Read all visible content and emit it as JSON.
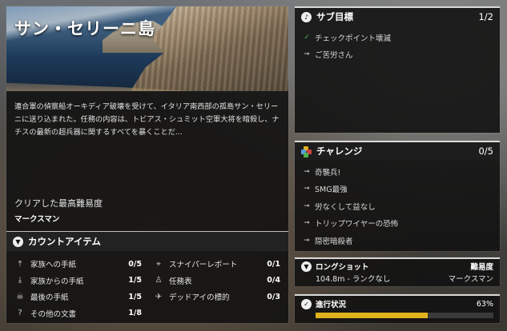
{
  "mission": {
    "title": "サン・セリーニ島",
    "description": "連合軍の偵察船オーキディア破壊を受けて、イタリア南西部の孤島サン・セリーニに送り込まれた。任務の内容は、トビアス・シュミット空軍大将を暗殺し、ナチスの最新の超兵器に関するすべてを暴くことだ...",
    "difficulty_label": "クリアした最高難易度",
    "difficulty_value": "マークスマン"
  },
  "collectibles": {
    "title": "カウントアイテム",
    "items": [
      {
        "icon": "letter-up-icon",
        "label": "家族への手紙",
        "count": "0/5"
      },
      {
        "icon": "crosshair-icon",
        "label": "スナイパーレポート",
        "count": "0/1"
      },
      {
        "icon": "letter-down-icon",
        "label": "家族からの手紙",
        "count": "1/5"
      },
      {
        "icon": "duty-icon",
        "label": "任務表",
        "count": "0/4"
      },
      {
        "icon": "skull-icon",
        "label": "最後の手紙",
        "count": "1/5"
      },
      {
        "icon": "eagle-icon",
        "label": "デッドアイの標的",
        "count": "0/3"
      },
      {
        "icon": "question-icon",
        "label": "その他の文書",
        "count": "1/8"
      }
    ]
  },
  "subgoals": {
    "title": "サブ目標",
    "count": "1/2",
    "items": [
      {
        "label": "チェックポイント壊滅",
        "done": true
      },
      {
        "label": "ご苦労さん",
        "done": false
      }
    ]
  },
  "challenges": {
    "title": "チャレンジ",
    "count": "0/5",
    "items": [
      "奇襲兵!",
      "SMG最強",
      "労なくして益なし",
      "トリップワイヤーの恐怖",
      "隠密暗殺者"
    ]
  },
  "longshot": {
    "title": "ロングショット",
    "difficulty_label": "難易度",
    "value": "104.8m - ランクなし",
    "difficulty_value": "マークスマン"
  },
  "progress": {
    "title": "進行状況",
    "percent_text": "63%",
    "fraction": 0.63,
    "bar_color": "#e0b21c"
  },
  "colors": {
    "check": "#4caf50",
    "accent": "#e0b21c"
  }
}
